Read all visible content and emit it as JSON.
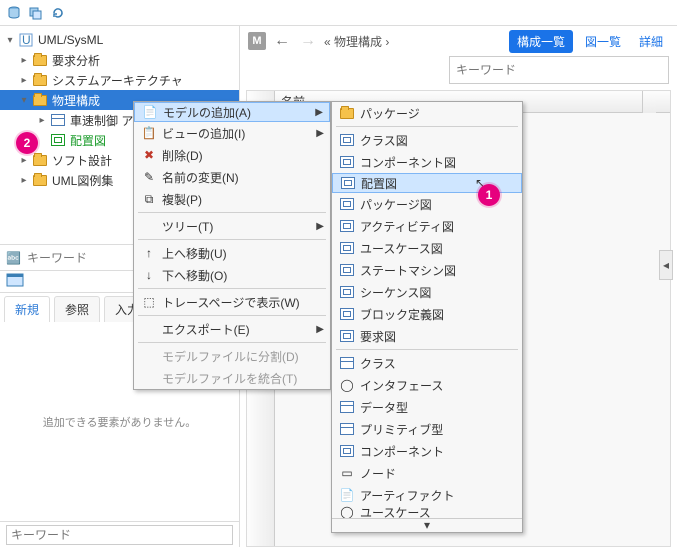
{
  "topbar": {
    "icons": [
      "db-icon",
      "db-stack-icon",
      "refresh-icon"
    ]
  },
  "tree": {
    "root": "UML/SysML",
    "items": [
      {
        "label": "要求分析"
      },
      {
        "label": "システムアーキテクチャ"
      },
      {
        "label": "物理構成",
        "selected": true
      },
      {
        "label": "車速制御 アク",
        "child": true
      },
      {
        "label": "配置図",
        "child": true,
        "green": true
      },
      {
        "label": "ソフト設計"
      },
      {
        "label": "UML図例集"
      }
    ]
  },
  "leftSearch": {
    "placeholder": "キーワード"
  },
  "leftTabs": {
    "new": "新規",
    "browse": "参照",
    "input": "入力"
  },
  "leftEmpty": "追加できる要素がありません。",
  "leftBottomSearch": {
    "placeholder": "キーワード"
  },
  "rightHeader": {
    "badge": "M",
    "crumb_prefix": "«",
    "crumb": "物理構成",
    "crumb_suffix": "›",
    "btn": "構成一覧",
    "link1": "図一覧",
    "link2": "詳細"
  },
  "rightSearch": {
    "placeholder": "キーワード"
  },
  "rightTable": {
    "col1": "名前"
  },
  "ctx1": {
    "items": [
      {
        "label": "モデルの追加(A)",
        "arrow": true,
        "highlight": true
      },
      {
        "label": "ビューの追加(I)",
        "arrow": true
      },
      {
        "label": "削除(D)"
      },
      {
        "label": "名前の変更(N)"
      },
      {
        "label": "複製(P)"
      },
      {
        "sep": true
      },
      {
        "label": "ツリー(T)",
        "arrow": true
      },
      {
        "sep": true
      },
      {
        "label": "上へ移動(U)"
      },
      {
        "label": "下へ移動(O)"
      },
      {
        "sep": true
      },
      {
        "label": "トレースページで表示(W)"
      },
      {
        "sep": true
      },
      {
        "label": "エクスポート(E)",
        "arrow": true
      },
      {
        "sep": true
      },
      {
        "label": "モデルファイルに分割(D)",
        "disabled": true
      },
      {
        "label": "モデルファイルを統合(T)",
        "disabled": true
      }
    ]
  },
  "ctx2": {
    "items": [
      {
        "label": "パッケージ",
        "folder": true
      },
      {
        "sep": true
      },
      {
        "label": "クラス図"
      },
      {
        "label": "コンポーネント図"
      },
      {
        "label": "配置図",
        "highlight": true
      },
      {
        "label": "パッケージ図"
      },
      {
        "label": "アクティビティ図"
      },
      {
        "label": "ユースケース図"
      },
      {
        "label": "ステートマシン図"
      },
      {
        "label": "シーケンス図"
      },
      {
        "label": "ブロック定義図"
      },
      {
        "label": "要求図"
      },
      {
        "sep": true
      },
      {
        "label": "クラス"
      },
      {
        "label": "インタフェース"
      },
      {
        "label": "データ型"
      },
      {
        "label": "プリミティブ型"
      },
      {
        "label": "コンポーネント"
      },
      {
        "label": "ノード"
      },
      {
        "label": "アーティファクト"
      },
      {
        "label": "ユースケース",
        "cut": true
      }
    ]
  },
  "callouts": {
    "one": "1",
    "two": "2"
  }
}
